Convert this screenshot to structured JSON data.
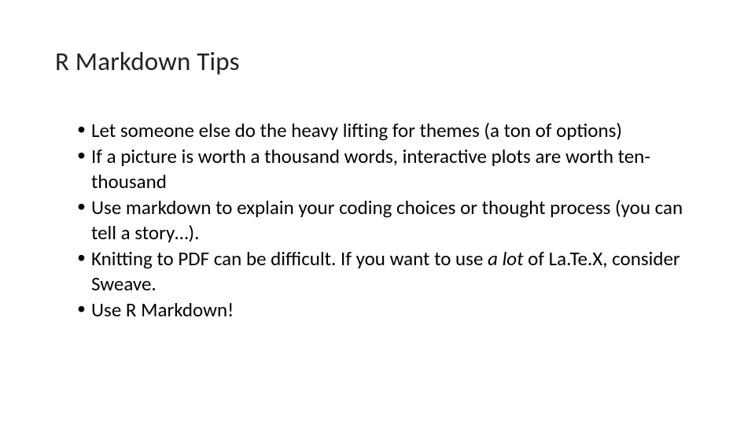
{
  "title": "R Markdown Tips",
  "bullets": {
    "item0": "Let someone else do the heavy lifting for themes (a ton of options)",
    "item1": "If a picture is worth a thousand words, interactive plots are worth ten-thousand",
    "item2": "Use markdown to explain your coding choices or thought process (you can tell a story…).",
    "item3_pre": "Knitting to PDF can be difficult. If you want to use ",
    "item3_em": "a lot ",
    "item3_post": "of La.Te.X, consider Sweave.",
    "item4": "Use R Markdown!"
  }
}
